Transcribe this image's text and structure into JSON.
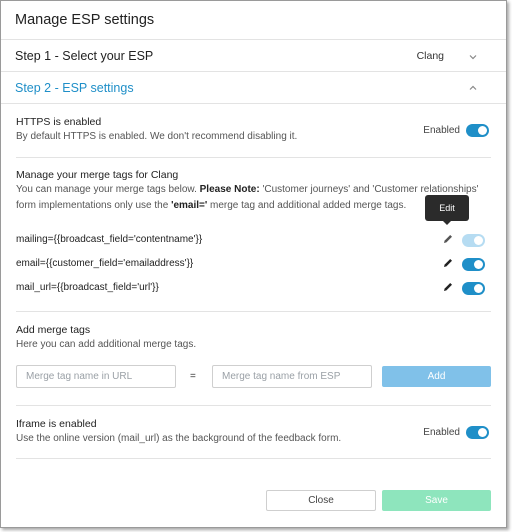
{
  "dialog": {
    "title": "Manage ESP settings"
  },
  "step1": {
    "label": "Step 1 - Select your ESP",
    "value": "Clang",
    "chevron": "chevron-down-icon"
  },
  "step2": {
    "label": "Step 2 - ESP settings",
    "chevron": "chevron-up-icon"
  },
  "https": {
    "title": "HTTPS is enabled",
    "description": "By default HTTPS is enabled. We don't recommend disabling it.",
    "toggle_label": "Enabled",
    "enabled": true
  },
  "merge_tags": {
    "title": "Manage your merge tags for Clang",
    "desc_line1_a": "You can manage your merge tags below. ",
    "desc_line1_b": "Please Note:",
    "desc_line1_c": " 'Customer journeys' and 'Customer relationships'",
    "desc_line2_a": "form implementations only use the ",
    "desc_line2_b": "'email='",
    "desc_line2_c": " merge tag and additional added merge tags.",
    "tooltip": "Edit",
    "rows": [
      {
        "text": "mailing={{broadcast_field='contentname'}}",
        "enabled": true,
        "disabled": true
      },
      {
        "text": "email={{customer_field='emailaddress'}}",
        "enabled": true,
        "disabled": false
      },
      {
        "text": "mail_url={{broadcast_field='url'}}",
        "enabled": true,
        "disabled": false
      }
    ]
  },
  "add_tags": {
    "title": "Add merge tags",
    "description": "Here you can add additional merge tags.",
    "url_placeholder": "Merge tag name in URL",
    "equals": "=",
    "esp_placeholder": "Merge tag name from ESP",
    "add_label": "Add"
  },
  "iframe": {
    "title": "Iframe is enabled",
    "description": "Use the online version (mail_url) as the background of the feedback form.",
    "toggle_label": "Enabled",
    "enabled": true
  },
  "footer": {
    "close_label": "Close",
    "save_label": "Save"
  },
  "colors": {
    "accent": "#1f8fc8",
    "save": "#8ee5bd",
    "add": "#80c1e9"
  }
}
